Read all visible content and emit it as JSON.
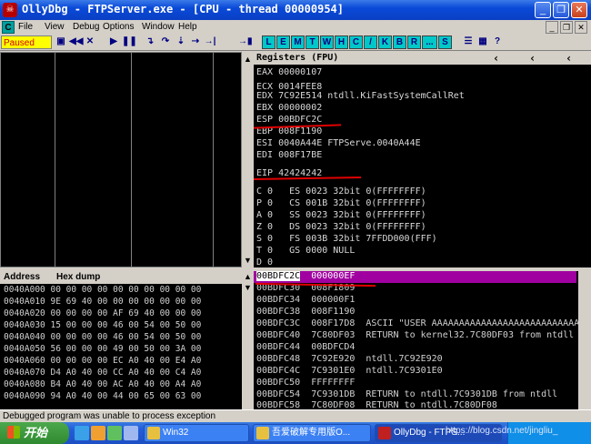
{
  "window": {
    "title": "OllyDbg - FTPServer.exe - [CPU - thread 00000954]",
    "buttons": [
      "_",
      "❐",
      "✕"
    ]
  },
  "menu": {
    "icon_letter": "C",
    "items": [
      "File",
      "View",
      "Debug",
      "Options",
      "Window",
      "Help"
    ],
    "mdi_buttons": [
      "_",
      "❐",
      "✕"
    ]
  },
  "toolbar": {
    "status": "Paused",
    "letters": [
      "L",
      "E",
      "M",
      "T",
      "W",
      "H",
      "C",
      "/",
      "K",
      "B",
      "R",
      "...",
      "S"
    ]
  },
  "registers": {
    "header": "Registers (FPU)",
    "lines": [
      "EAX 00000107",
      "ECX 0014FEE8",
      "EDX 7C92E514 ntdll.KiFastSystemCallRet",
      "EBX 00000002",
      "ESP 00BDFC2C",
      "EBP 008F1190",
      "ESI 0040A44E FTPServe.0040A44E",
      "EDI 008F17BE",
      "",
      "EIP 42424242",
      "",
      "C 0   ES 0023 32bit 0(FFFFFFFF)",
      "P 0   CS 001B 32bit 0(FFFFFFFF)",
      "A 0   SS 0023 32bit 0(FFFFFFFF)",
      "Z 0   DS 0023 32bit 0(FFFFFFFF)",
      "S 0   FS 003B 32bit 7FFDD000(FFF)",
      "T 0   GS 0000 NULL",
      "D 0"
    ]
  },
  "dump": {
    "col_address": "Address",
    "col_hex": "Hex dump",
    "rows": [
      "0040A000 00 00 00 00 00 00 00 00 00 00",
      "0040A010 9E 69 40 00 00 00 00 00 00 00",
      "0040A020 00 00 00 00 AF 69 40 00 00 00",
      "0040A030 15 00 00 00 46 00 54 00 50 00",
      "0040A040 00 00 00 00 46 00 54 00 50 00",
      "0040A050 56 00 00 00 49 00 50 00 3A 00",
      "0040A060 00 00 00 00 EC A0 40 00 E4 A0",
      "0040A070 D4 A0 40 00 CC A0 40 00 C4 A0",
      "0040A080 B4 A0 40 00 AC A0 40 00 A4 A0",
      "0040A090 94 A0 40 00 44 00 65 00 63 00"
    ]
  },
  "stack": {
    "selected_addr": "00BDFC2C",
    "selected_val": "000000EF",
    "rows": [
      "00BDFC30  008F1809",
      "00BDFC34  000000F1",
      "00BDFC38  008F1190",
      "00BDFC3C  008F17D8  ASCII \"USER AAAAAAAAAAAAAAAAAAAAAAAAAAAA",
      "00BDFC40  7C80DF03  RETURN to kernel32.7C80DF03 from ntdll",
      "00BDFC44  00BDFCD4",
      "00BDFC48  7C92E920  ntdll.7C92E920",
      "00BDFC4C  7C9301E0  ntdll.7C9301E0",
      "00BDFC50  FFFFFFFF",
      "00BDFC54  7C9301DB  RETURN to ntdll.7C9301DB from ntdll",
      "00BDFC58  7C80DF08  RETURN to ntdll.7C80DF08"
    ]
  },
  "status_bar": "Debugged program was unable to process exception",
  "taskbar": {
    "start": "开始",
    "tasks": [
      "Win32",
      "吾爱破解专用版O...",
      "OllyDbg - FTPS..."
    ],
    "watermark": "https://blog.csdn.net/jingliu_"
  },
  "colors": {
    "title": "#0a4ad8",
    "paused": "#ffff00",
    "highlight": "#a000a0",
    "annotation": "#e00000"
  }
}
